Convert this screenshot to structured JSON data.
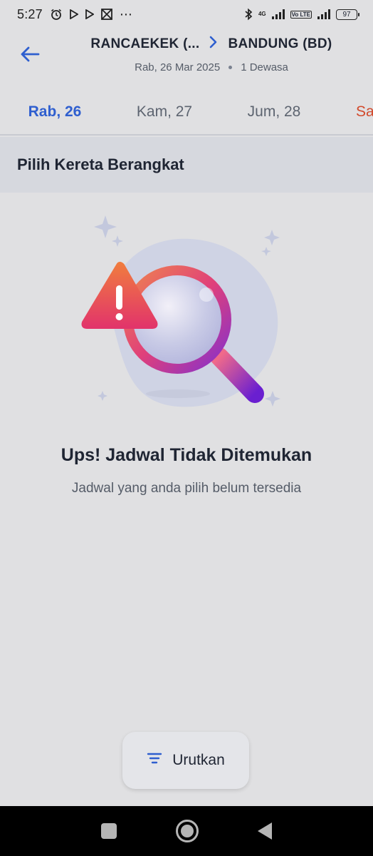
{
  "status_bar": {
    "time": "5:27",
    "network_tag": "4G",
    "volte_tag": "Vo LTE",
    "battery": "97"
  },
  "header": {
    "origin": "RANCAEKEK (...",
    "destination": "BANDUNG (BD)",
    "date": "Rab, 26 Mar 2025",
    "passengers": "1 Dewasa"
  },
  "tabs": [
    {
      "label": "Rab, 26",
      "active": true
    },
    {
      "label": "Kam, 27",
      "active": false
    },
    {
      "label": "Jum, 28",
      "active": false
    },
    {
      "label": "Sa",
      "active": false
    }
  ],
  "section_title": "Pilih Kereta Berangkat",
  "empty_state": {
    "title": "Ups! Jadwal Tidak Ditemukan",
    "subtitle": "Jadwal yang anda pilih belum tersedia",
    "icon": "search-not-found-illustration"
  },
  "sort_button": {
    "label": "Urutkan",
    "icon": "filter-lines-icon"
  },
  "colors": {
    "accent": "#2f5fcf",
    "weekend": "#d24a2c",
    "background": "#e0e0e2",
    "section_bg": "#d6d8de"
  }
}
